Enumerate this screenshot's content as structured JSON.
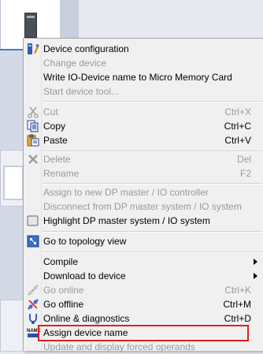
{
  "menu": {
    "items": [
      {
        "label": "Device configuration",
        "shortcut": "",
        "enabled": true,
        "icon": "device-configuration-icon"
      },
      {
        "label": "Change device",
        "shortcut": "",
        "enabled": false,
        "icon": ""
      },
      {
        "label": "Write IO-Device name to Micro Memory Card",
        "shortcut": "",
        "enabled": true,
        "icon": ""
      },
      {
        "label": "Start device tool...",
        "shortcut": "",
        "enabled": false,
        "icon": ""
      },
      {
        "label": "Cut",
        "shortcut": "Ctrl+X",
        "enabled": false,
        "icon": "scissors-icon"
      },
      {
        "label": "Copy",
        "shortcut": "Ctrl+C",
        "enabled": true,
        "icon": "copy-icon"
      },
      {
        "label": "Paste",
        "shortcut": "Ctrl+V",
        "enabled": true,
        "icon": "paste-icon"
      },
      {
        "label": "Delete",
        "shortcut": "Del",
        "enabled": false,
        "icon": "delete-icon"
      },
      {
        "label": "Rename",
        "shortcut": "F2",
        "enabled": false,
        "icon": ""
      },
      {
        "label": "Assign to new DP master / IO controller",
        "shortcut": "",
        "enabled": false,
        "icon": ""
      },
      {
        "label": "Disconnect from DP master system / IO system",
        "shortcut": "",
        "enabled": false,
        "icon": ""
      },
      {
        "label": "Highlight DP master system / IO system",
        "shortcut": "",
        "enabled": true,
        "icon": "highlight-icon"
      },
      {
        "label": "Go to topology view",
        "shortcut": "",
        "enabled": true,
        "icon": "topology-icon"
      },
      {
        "label": "Compile",
        "shortcut": "",
        "enabled": true,
        "icon": "",
        "submenu": true
      },
      {
        "label": "Download to device",
        "shortcut": "",
        "enabled": true,
        "icon": "",
        "submenu": true
      },
      {
        "label": "Go online",
        "shortcut": "Ctrl+K",
        "enabled": false,
        "icon": "go-online-icon"
      },
      {
        "label": "Go offline",
        "shortcut": "Ctrl+M",
        "enabled": true,
        "icon": "go-offline-icon"
      },
      {
        "label": "Online & diagnostics",
        "shortcut": "Ctrl+D",
        "enabled": true,
        "icon": "online-diagnostics-icon"
      },
      {
        "label": "Assign device name",
        "shortcut": "",
        "enabled": true,
        "icon": "assign-name-icon"
      },
      {
        "label": "Update and display forced operands",
        "shortcut": "",
        "enabled": false,
        "icon": ""
      }
    ],
    "icon_text": {
      "assign_name": "NAME"
    }
  },
  "colors": {
    "highlight_border": "#e02020",
    "background": "#f0f0f0",
    "disabled_text": "#9a9a9a"
  }
}
